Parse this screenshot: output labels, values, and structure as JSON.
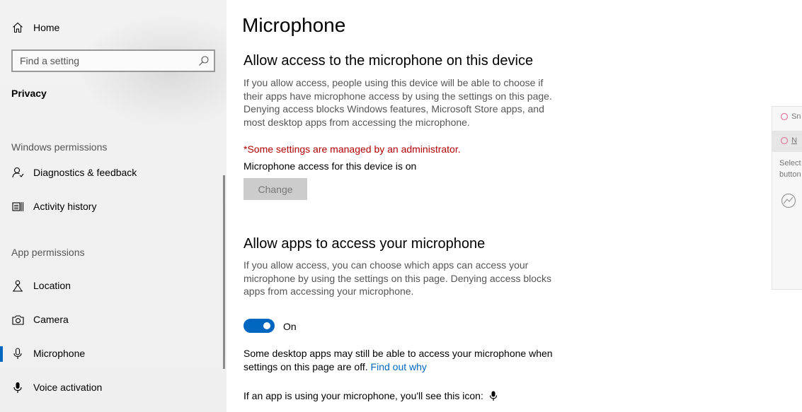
{
  "sidebar": {
    "home_label": "Home",
    "search_placeholder": "Find a setting",
    "section_title": "Privacy",
    "windows_permissions_label": "Windows permissions",
    "app_permissions_label": "App permissions",
    "windows_items": [
      {
        "label": "Diagnostics & feedback",
        "icon": "diagnostics-icon"
      },
      {
        "label": "Activity history",
        "icon": "activity-history-icon"
      }
    ],
    "app_items": [
      {
        "label": "Location",
        "icon": "location-icon"
      },
      {
        "label": "Camera",
        "icon": "camera-icon"
      },
      {
        "label": "Microphone",
        "icon": "microphone-icon",
        "selected": true
      },
      {
        "label": "Voice activation",
        "icon": "voice-activation-icon"
      }
    ]
  },
  "main": {
    "title": "Microphone",
    "device_section": {
      "heading": "Allow access to the microphone on this device",
      "description_lines": [
        "If you allow access, people using this device will be able to choose if",
        "their apps have microphone access by using the settings on this page.",
        "Denying access blocks Windows features, Microsoft Store apps, and",
        "most desktop apps from accessing the microphone."
      ],
      "managed_notice": "*Some settings are managed by an administrator.",
      "status": "Microphone access for this device is on",
      "change_button": "Change"
    },
    "apps_section": {
      "heading": "Allow apps to access your microphone",
      "description_lines": [
        "If you allow access, you can choose which apps can access your",
        "microphone by using the settings on this page. Denying access blocks",
        "apps from accessing your microphone."
      ],
      "toggle_state": "On",
      "note_lines": [
        "Some desktop apps may still be able to access your microphone when",
        "settings on this page are off."
      ],
      "note_link": "Find out why",
      "icon_line": "If an app is using your microphone, you'll see this icon:"
    }
  },
  "overlay": {
    "row1": "Sn",
    "row2": "N",
    "row3": "Select",
    "row4": "button"
  },
  "colors": {
    "accent": "#0067c0",
    "admin_notice": "#b00000",
    "sidebar_bg": "#f2f2f2"
  }
}
